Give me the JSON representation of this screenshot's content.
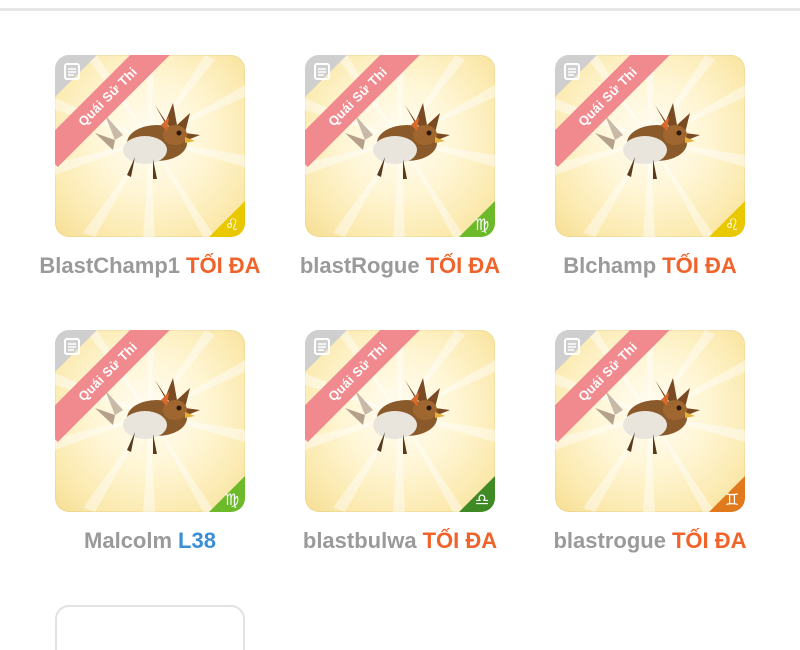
{
  "ribbon_text": "Quái Sử Thi",
  "zodiac_colors": {
    "leo": "#e9c800",
    "virgo": "#6cba2a",
    "libra": "#3f8a24",
    "gemini": "#e07a1c"
  },
  "level_colors": {
    "max": "#f0642b",
    "normal": "#3a8fd6"
  },
  "cards": [
    {
      "name": "BlastChamp1",
      "level": "TỐI ĐA",
      "level_type": "max",
      "zodiac_icon": "leo-icon",
      "zodiac_glyph": "♌",
      "zodiac_color": "#e9c800"
    },
    {
      "name": "blastRogue",
      "level": "TỐI ĐA",
      "level_type": "max",
      "zodiac_icon": "virgo-icon",
      "zodiac_glyph": "♍",
      "zodiac_color": "#6cba2a"
    },
    {
      "name": "Blchamp",
      "level": "TỐI ĐA",
      "level_type": "max",
      "zodiac_icon": "leo-icon",
      "zodiac_glyph": "♌",
      "zodiac_color": "#e9c800"
    },
    {
      "name": "Malcolm",
      "level": "L38",
      "level_type": "normal",
      "zodiac_icon": "virgo-icon",
      "zodiac_glyph": "♍",
      "zodiac_color": "#6cba2a"
    },
    {
      "name": "blastbulwa",
      "level": "TỐI ĐA",
      "level_type": "max",
      "zodiac_icon": "libra-icon",
      "zodiac_glyph": "♎",
      "zodiac_color": "#3f8a24"
    },
    {
      "name": "blastrogue",
      "level": "TỐI ĐA",
      "level_type": "max",
      "zodiac_icon": "gemini-icon",
      "zodiac_glyph": "♊",
      "zodiac_color": "#e07a1c"
    }
  ]
}
